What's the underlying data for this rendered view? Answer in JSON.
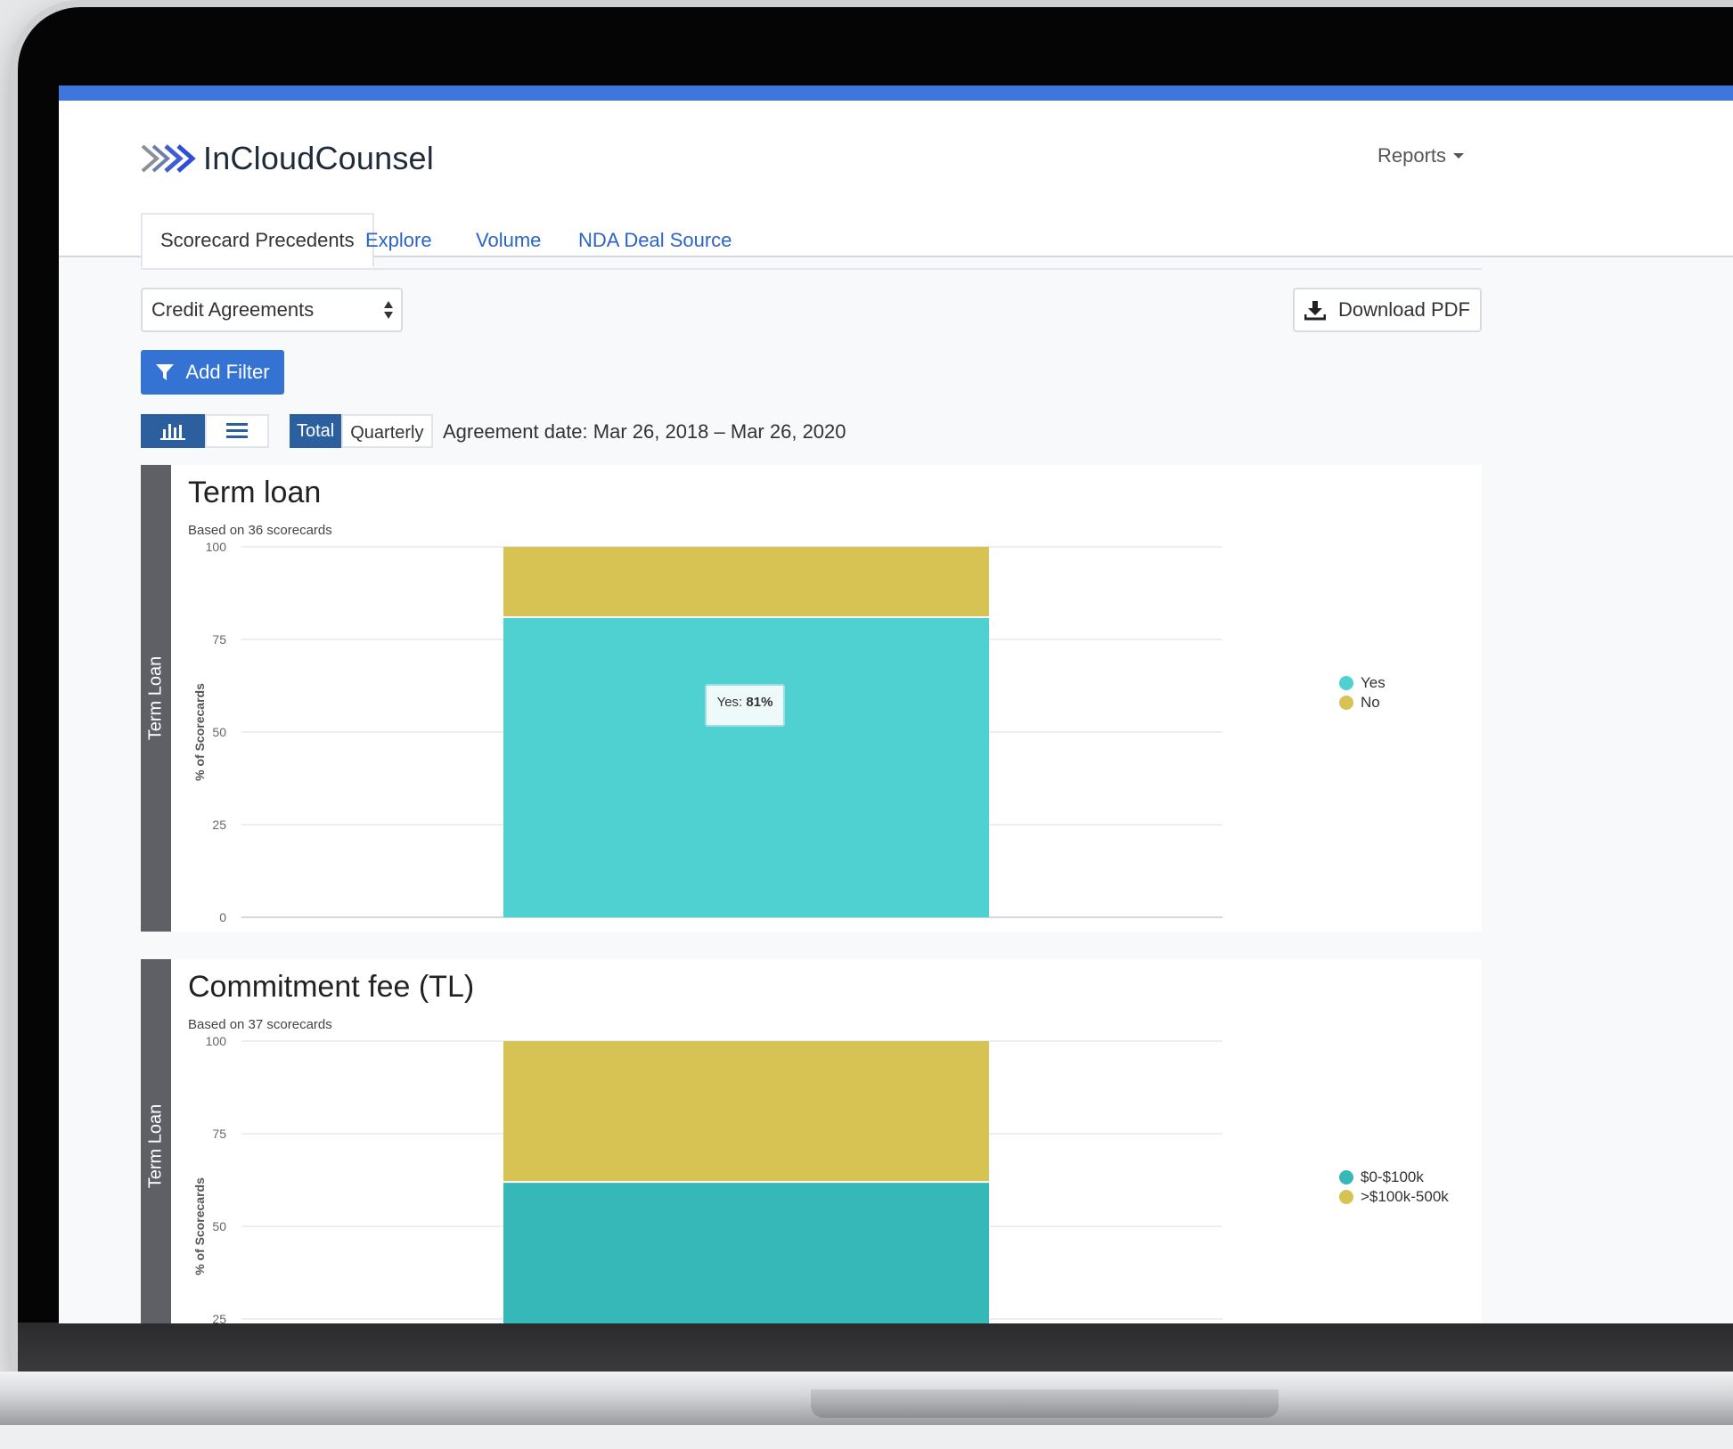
{
  "app": {
    "logo": "InCloudCounsel",
    "reports_menu": "Reports"
  },
  "tabs": [
    {
      "label": "Scorecard Precedents",
      "active": true
    },
    {
      "label": "Explore",
      "active": false
    },
    {
      "label": "Volume",
      "active": false
    },
    {
      "label": "NDA Deal Source",
      "active": false
    }
  ],
  "controls": {
    "agreement_type": "Credit Agreements",
    "download": "Download PDF",
    "add_filter": "Add Filter",
    "period_total": "Total",
    "period_quarterly": "Quarterly",
    "date_range": "Agreement date: Mar 26, 2018 – Mar 26, 2020"
  },
  "icons": {
    "chart_view": "bar-chart-icon",
    "list_view": "list-icon",
    "download": "download-icon",
    "filter": "filter-icon",
    "select": "up-down-arrows-icon"
  },
  "colors": {
    "accent": "#3473d4",
    "top_bar": "#3f76dd",
    "teal": "#4fd1d2",
    "teal_dark": "#36b8b9",
    "mustard": "#d7c254",
    "side_label_bg": "#5f6066"
  },
  "charts": [
    {
      "side_label": "Term Loan",
      "title": "Term loan",
      "subtitle": "Based on 36 scorecards",
      "tooltip": {
        "label": "Yes:",
        "value": "81%"
      },
      "legend": [
        "Yes",
        "No"
      ]
    },
    {
      "side_label": "Term Loan",
      "title": "Commitment fee (TL)",
      "subtitle": "Based on 37 scorecards",
      "legend": [
        "$0-$100k",
        ">$100k-500k"
      ]
    }
  ],
  "chart_data": [
    {
      "type": "bar",
      "stacked": true,
      "title": "Term loan",
      "ylabel": "% of Scorecards",
      "ylim": [
        0,
        100
      ],
      "yticks": [
        0,
        25,
        50,
        75,
        100
      ],
      "series": [
        {
          "name": "Yes",
          "values": [
            81
          ],
          "color": "#4fd1d2"
        },
        {
          "name": "No",
          "values": [
            19
          ],
          "color": "#d7c254"
        }
      ],
      "legend_position": "right",
      "grid": true
    },
    {
      "type": "bar",
      "stacked": true,
      "title": "Commitment fee (TL)",
      "ylabel": "% of Scorecards",
      "ylim": [
        0,
        100
      ],
      "yticks": [
        25,
        50,
        75,
        100
      ],
      "series": [
        {
          "name": "$0-$100k",
          "values": [
            62
          ],
          "color": "#36b8b9"
        },
        {
          "name": ">$100k-500k",
          "values": [
            38
          ],
          "color": "#d7c254"
        }
      ],
      "legend_position": "right",
      "grid": true
    }
  ]
}
